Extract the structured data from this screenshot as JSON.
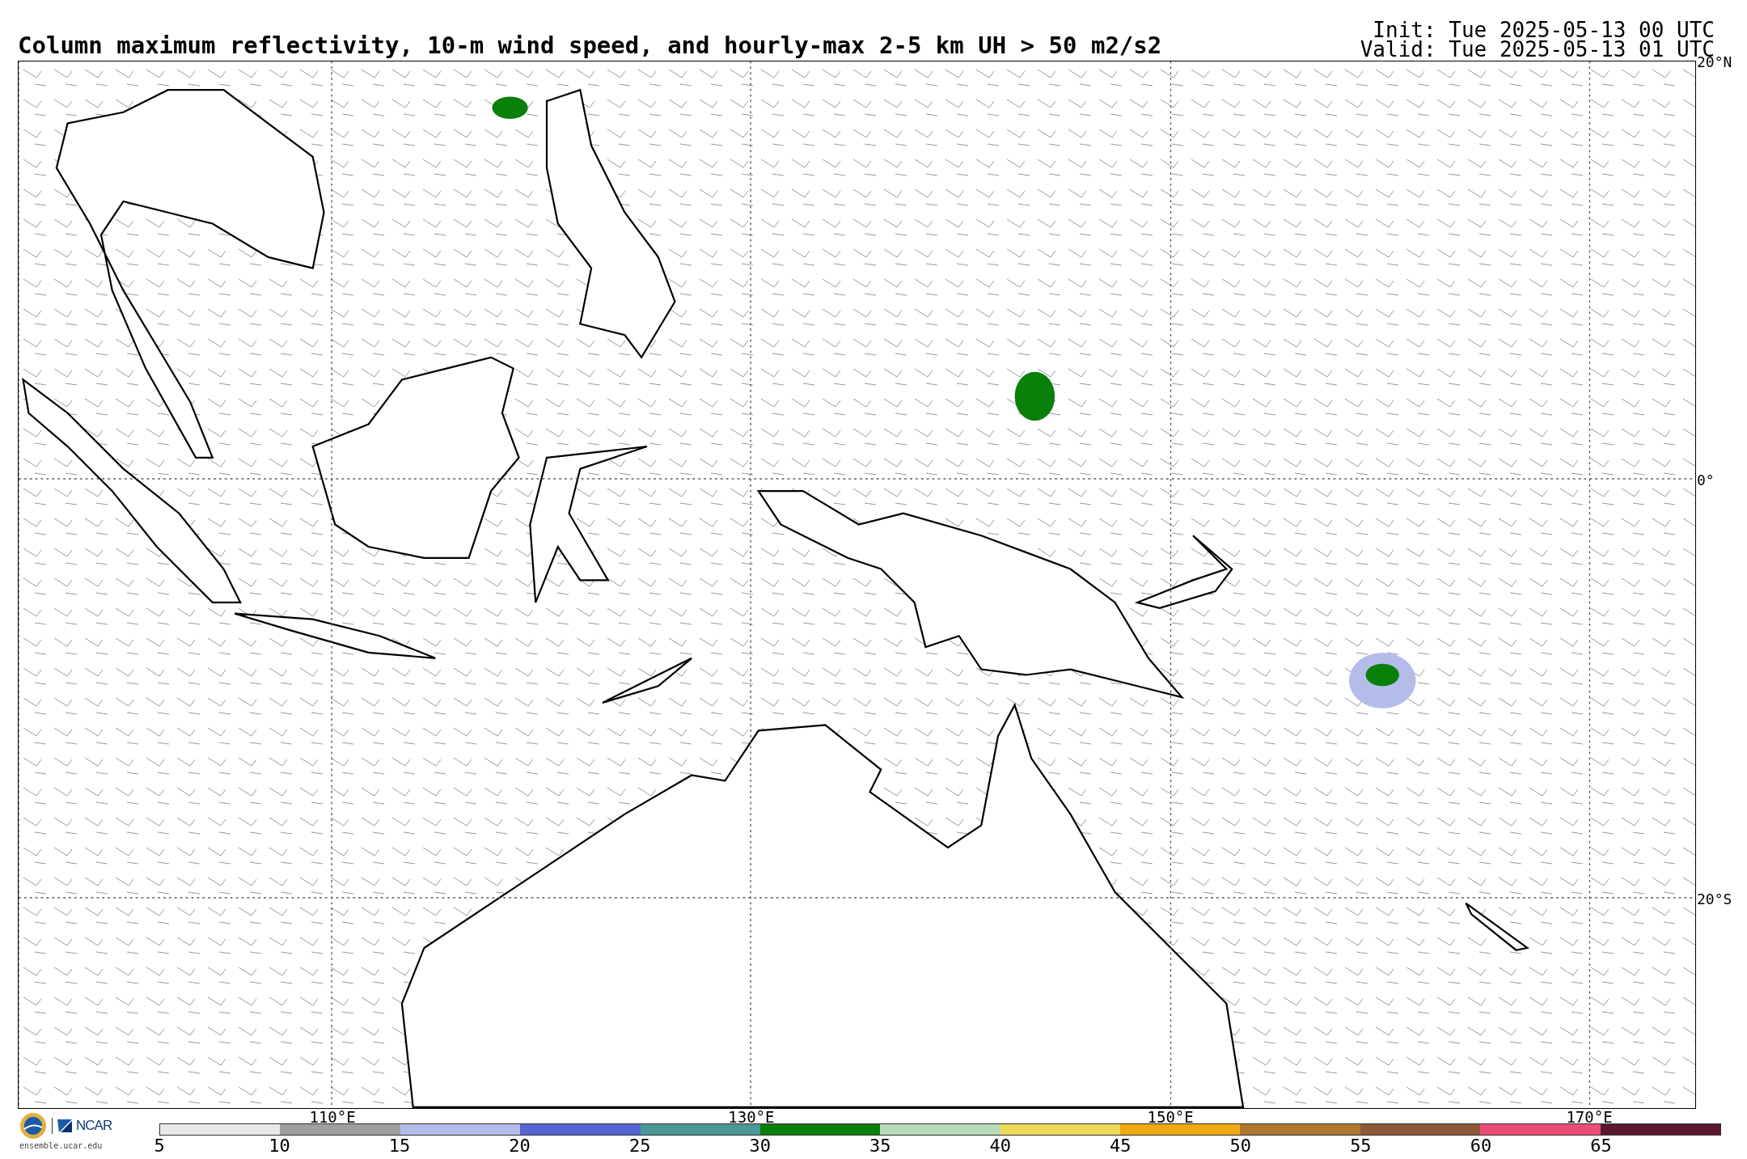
{
  "title": "Column maximum reflectivity, 10-m wind speed, and hourly-max 2-5 km UH > 50 m2/s2",
  "init": "Init: Tue 2025-05-13 00 UTC",
  "valid": "Valid: Tue 2025-05-13 01 UTC",
  "map": {
    "latitude_labels": [
      "20°N",
      "0°",
      "20°S"
    ],
    "longitude_labels": [
      "110°E",
      "130°E",
      "150°E",
      "170°E"
    ]
  },
  "colorbar": {
    "segments": [
      {
        "color": "#e8e8e8"
      },
      {
        "color": "#a0a0a0"
      },
      {
        "color": "#b4bcea"
      },
      {
        "color": "#5566d4"
      },
      {
        "color": "#4a9898"
      },
      {
        "color": "#0a800a"
      },
      {
        "color": "#b8dcb8"
      },
      {
        "color": "#f0d858"
      },
      {
        "color": "#eeaa10"
      },
      {
        "color": "#b07830"
      },
      {
        "color": "#8c5838"
      },
      {
        "color": "#ec4c78"
      },
      {
        "color": "#5c1830"
      }
    ],
    "ticks": [
      "5",
      "10",
      "15",
      "20",
      "25",
      "30",
      "35",
      "40",
      "45",
      "50",
      "55",
      "60",
      "65"
    ]
  },
  "footer": {
    "logo_text": "NCAR",
    "url": "ensemble.ucar.edu"
  }
}
